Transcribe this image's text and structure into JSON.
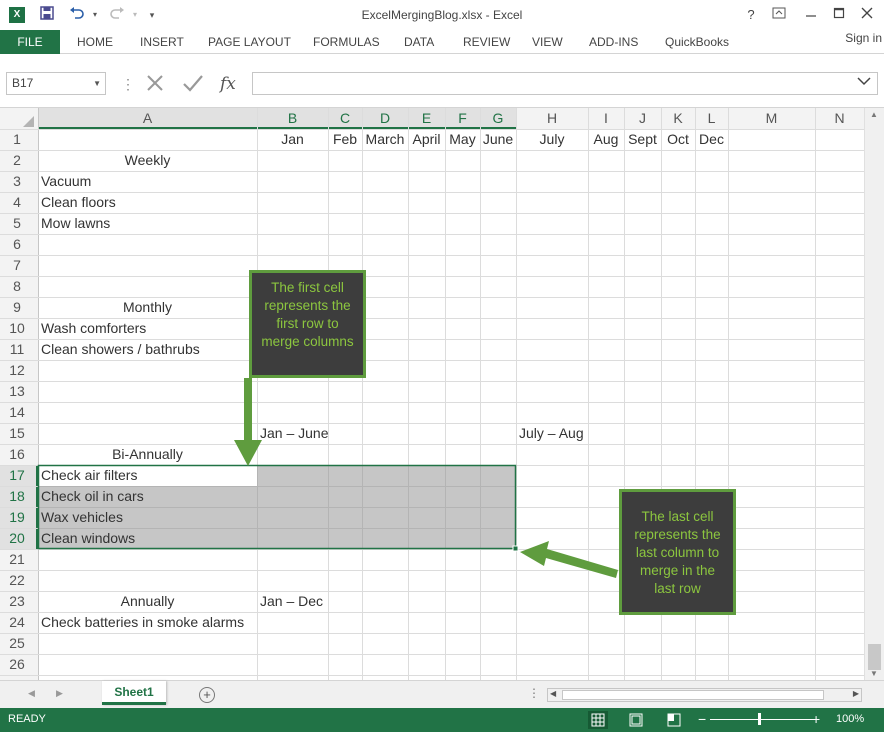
{
  "titlebar": {
    "app_icon": "X",
    "title": "ExcelMergingBlog.xlsx - Excel",
    "help": "?",
    "icons": [
      "excel-icon",
      "save-icon",
      "undo-icon",
      "redo-icon",
      "customize-icon"
    ]
  },
  "ribbon": {
    "file": "FILE",
    "tabs": [
      "HOME",
      "INSERT",
      "PAGE LAYOUT",
      "FORMULAS",
      "DATA",
      "REVIEW",
      "VIEW",
      "ADD-INS",
      "QuickBooks"
    ],
    "signin": "Sign in"
  },
  "formula_bar": {
    "name_box": "B17",
    "fx": "fx",
    "formula": ""
  },
  "grid": {
    "columns": [
      "A",
      "B",
      "C",
      "D",
      "E",
      "F",
      "G",
      "H",
      "I",
      "J",
      "K",
      "L",
      "M",
      "N"
    ],
    "rows": [
      "1",
      "2",
      "3",
      "4",
      "5",
      "6",
      "7",
      "8",
      "9",
      "10",
      "11",
      "12",
      "13",
      "14",
      "15",
      "16",
      "17",
      "18",
      "19",
      "20",
      "21",
      "22",
      "23",
      "24",
      "25",
      "26"
    ],
    "cells": {
      "B1": "Jan",
      "C1": "Feb",
      "D1": "March",
      "E1": "April",
      "F1": "May",
      "G1": "June",
      "H1": "July",
      "I1": "Aug",
      "J1": "Sept",
      "K1": "Oct",
      "L1": "Dec",
      "A2": "Weekly",
      "A3": "Vacuum",
      "A4": "Clean floors",
      "A5": "Mow lawns",
      "A9": "Monthly",
      "A10": "Wash comforters",
      "A11": "Clean showers / bathrubs",
      "B15": "Jan – June",
      "H15": "July – Aug",
      "A16": "Bi-Annually",
      "A17": "Check air filters",
      "A18": "Check oil in cars",
      "A19": "Wax vehicles",
      "A20": "Clean windows",
      "A23": "Annually",
      "B23": "Jan – Dec",
      "A24": "Check batteries in smoke alarms"
    }
  },
  "callouts": {
    "first": "The first cell represents the first row to merge columns",
    "last": "The last cell represents the last column to merge in the last row"
  },
  "sheets": {
    "active": "Sheet1"
  },
  "status": {
    "ready": "READY",
    "zoom": "100%",
    "zoom_minus": "−",
    "zoom_plus": "+"
  },
  "colors": {
    "excel_green": "#217346",
    "callout_bg": "#3d3d3d",
    "callout_text": "#8cc63f",
    "arrow_green": "#5f9c3e",
    "selection_fill": "#c6c6c6"
  }
}
